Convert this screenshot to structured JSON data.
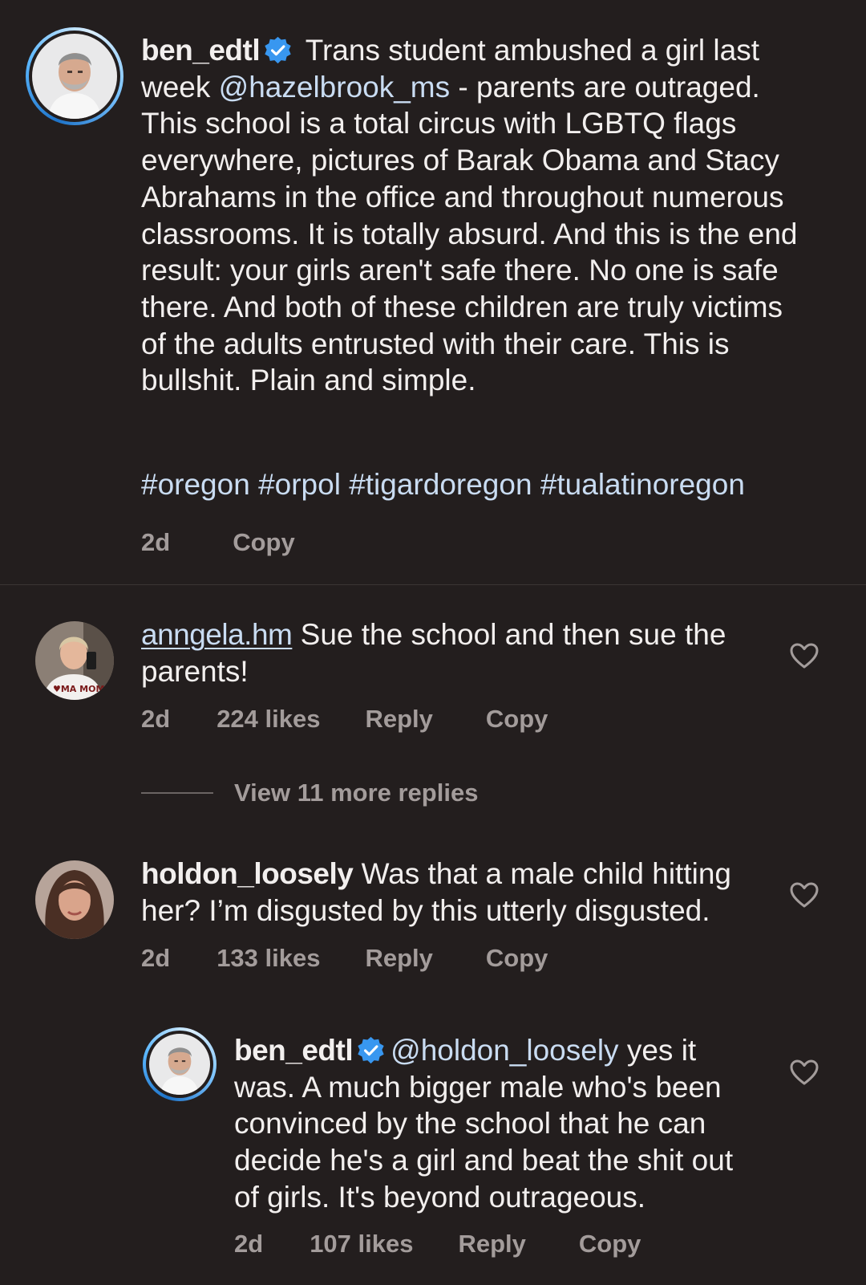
{
  "colors": {
    "background": "#231e1e",
    "text": "#f2efee",
    "muted": "#a39c9b",
    "link": "#c9dcf2",
    "verified": "#3897f0"
  },
  "caption": {
    "username": "ben_edtl",
    "text_part1": " Trans student ambushed a girl last week ",
    "mention": "@hazelbrook_ms",
    "text_part2": " - parents are outraged. This school is a total circus with LGBTQ flags everywhere, pictures of Barak Obama and Stacy Abrahams in the office and throughout numerous classrooms. It is totally absurd. And this is the end result: your girls aren't safe there. No one is safe there. And both of these children are truly victims of the adults entrusted with their care. This is bullshit. Plain and simple.",
    "hashtags": "#oregon #orpol #tigardoregon #tualatinoregon",
    "time": "2d",
    "copy_label": "Copy",
    "verified_icon": "verified-badge-icon"
  },
  "comments": [
    {
      "username": "anngela.hm",
      "text": " Sue the school and then sue the parents!",
      "time": "2d",
      "likes": "224 likes",
      "reply_label": "Reply",
      "copy_label": "Copy"
    },
    {
      "username": "holdon_loosely",
      "text": " Was that a male child hitting her? I’m disgusted by this utterly disgusted.",
      "time": "2d",
      "likes": "133 likes",
      "reply_label": "Reply",
      "copy_label": "Copy"
    }
  ],
  "view_more": "View 11 more replies",
  "reply": {
    "username": "ben_edtl",
    "mention": "@holdon_loosely",
    "text": " yes it was. A much bigger male who's been convinced by the school that he can decide he's a girl and beat the shit out of girls. It's beyond outrageous.",
    "time": "2d",
    "likes": "107 likes",
    "reply_label": "Reply",
    "copy_label": "Copy"
  }
}
